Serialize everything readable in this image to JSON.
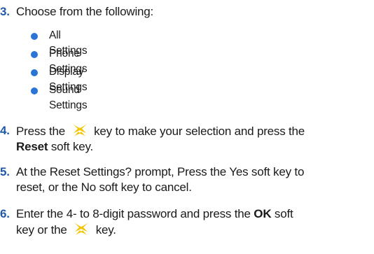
{
  "step3": {
    "number": "3.",
    "text": "Choose from the following:",
    "options": [
      "All Settings",
      "Phone Settings",
      "Display Settings",
      "Sound Settings"
    ]
  },
  "step4": {
    "number": "4.",
    "line1_before_icon": "Press the",
    "line1_after_icon": "key to make your selection and press the",
    "line2_bold": "Reset",
    "line2_rest": " soft key."
  },
  "step5": {
    "number": "5.",
    "line1": "At the Reset Settings? prompt, Press the Yes soft key to",
    "line2": "reset, or the No soft key to cancel."
  },
  "step6": {
    "number": "6.",
    "line1_before_bold": "Enter the 4- to 8-digit password and press the ",
    "line1_bold": "OK",
    "line1_after_bold": " soft",
    "line2_before_icon": "key or the",
    "line2_after_icon": "key."
  },
  "icons": {
    "nav_key": "navigation-key-icon",
    "bullet": "bullet-dot"
  },
  "colors": {
    "step_number": "#2159a8",
    "bullet": "#2a74d6",
    "nav_key": "#f5c400"
  }
}
